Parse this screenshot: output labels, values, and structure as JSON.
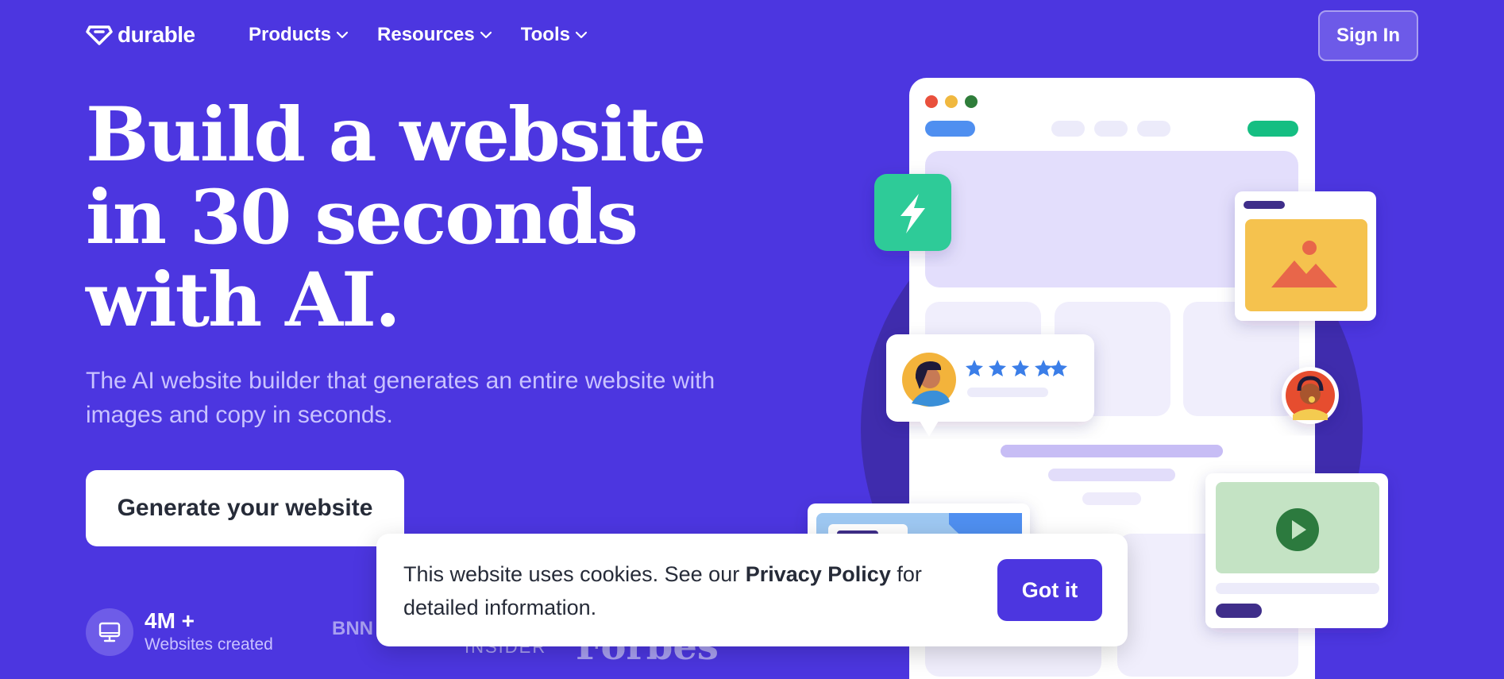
{
  "nav": {
    "logo_text": "durable",
    "items": [
      {
        "label": "Products"
      },
      {
        "label": "Resources"
      },
      {
        "label": "Tools"
      }
    ],
    "signin_label": "Sign In"
  },
  "hero": {
    "title_line1": "Build a website",
    "title_line2": "in 30 seconds",
    "title_line3": "with AI.",
    "subtitle": "The AI website builder that generates an entire website with images and copy in seconds.",
    "cta_label": "Generate your website"
  },
  "stats": {
    "value": "4M +",
    "label": "Websites created"
  },
  "press": {
    "logos": [
      "BNN Bloomberg",
      "INSIDER",
      "Forbes"
    ]
  },
  "cookie": {
    "text_before": "This website uses cookies. See our ",
    "link_label": "Privacy Policy",
    "text_after": " for detailed information.",
    "button_label": "Got it"
  },
  "illustration": {
    "review_rating": "5 of 5 stars",
    "icons": [
      "lightning-icon",
      "image-icon",
      "play-icon",
      "avatar-woman",
      "avatar-headset"
    ]
  },
  "colors": {
    "background": "#4c36e0",
    "accent_green": "#2ecb98",
    "image_yellow": "#f5c24e",
    "image_red": "#e8664a",
    "video_green": "#c4e3c4",
    "play_dark_green": "#2c7a3e",
    "text_dark": "#262b38"
  }
}
